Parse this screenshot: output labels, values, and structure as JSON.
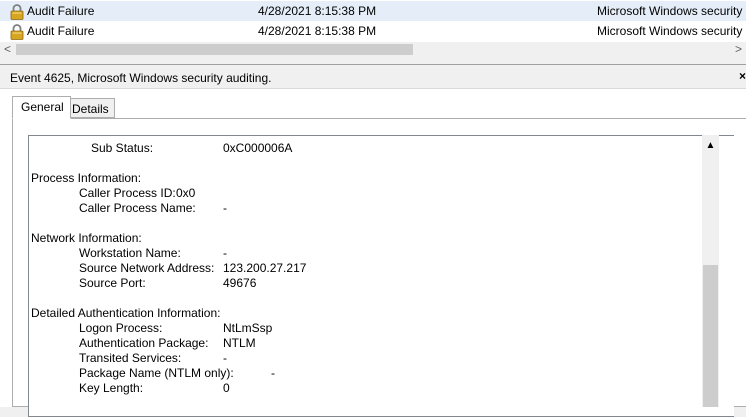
{
  "events": [
    {
      "level": "Audit Failure",
      "date": "4/28/2021 8:15:38 PM",
      "source": "Microsoft Windows security",
      "selected": true
    },
    {
      "level": "Audit Failure",
      "date": "4/28/2021 8:15:38 PM",
      "source": "Microsoft Windows security",
      "selected": false
    }
  ],
  "scroll": {
    "left_arrow": "<",
    "right_arrow": ">"
  },
  "detail": {
    "title": "Event 4625, Microsoft Windows security auditing.",
    "close": "×",
    "tabs": [
      {
        "label": "General",
        "active": true
      },
      {
        "label": "Details",
        "active": false
      }
    ]
  },
  "body": {
    "sub_status_label": "Sub Status:",
    "sub_status_value": "0xC000006A",
    "process_heading": "Process Information:",
    "caller_pid_label": "Caller Process ID:",
    "caller_pid_value": "0x0",
    "caller_name_label": "Caller Process Name:",
    "caller_name_value": "-",
    "network_heading": "Network Information:",
    "workstation_label": "Workstation Name:",
    "workstation_value": "-",
    "src_addr_label": "Source Network Address:",
    "src_addr_value": "123.200.27.217",
    "src_port_label": "Source Port:",
    "src_port_value": "49676",
    "auth_heading": "Detailed Authentication Information:",
    "logon_process_label": "Logon Process:",
    "logon_process_value": "NtLmSsp",
    "auth_package_label": "Authentication Package:",
    "auth_package_value": "NTLM",
    "transited_label": "Transited Services:",
    "transited_value": "-",
    "package_name_label": "Package Name (NTLM only):",
    "package_name_value": "-",
    "key_length_label": "Key Length:",
    "key_length_value": "0"
  },
  "colors": {
    "selected_row": "#e5eef8",
    "lock_body": "#d8a520",
    "lock_shackle": "#808080"
  }
}
